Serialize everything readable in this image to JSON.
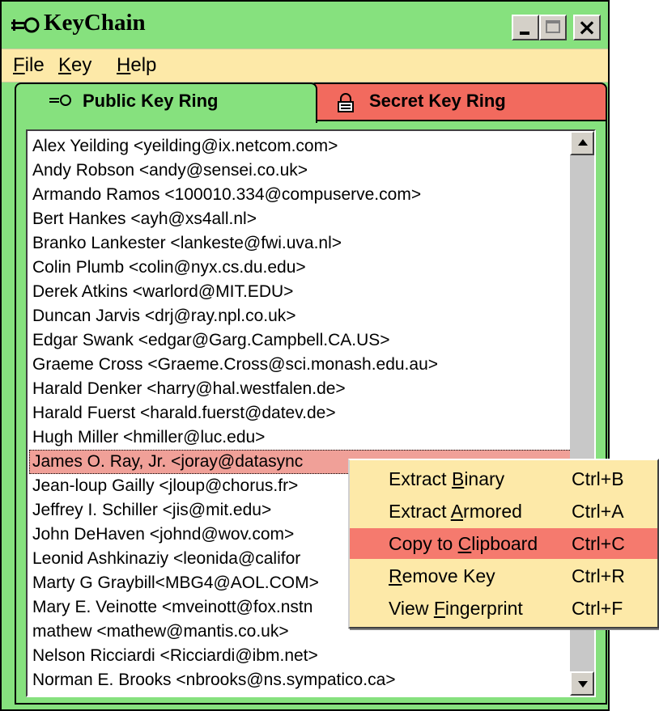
{
  "window": {
    "title": "KeyChain",
    "icon": "key-icon"
  },
  "menubar": [
    {
      "label": "File",
      "mnemonic": "F",
      "rest": "ile"
    },
    {
      "label": "Key",
      "mnemonic": "K",
      "rest": "ey"
    },
    {
      "label": "Help",
      "mnemonic": "H",
      "rest": "elp"
    }
  ],
  "tabs": [
    {
      "label": "Public Key Ring",
      "icon": "key-icon",
      "active": true,
      "color": "#86e17e"
    },
    {
      "label": "Secret Key Ring",
      "icon": "padlock-icon",
      "active": false,
      "color": "#f26a5e"
    }
  ],
  "keyring": {
    "selected_index": 13,
    "items": [
      "Alex Yeilding <yeilding@ix.netcom.com>",
      "Andy Robson <andy@sensei.co.uk>",
      "Armando Ramos <100010.334@compuserve.com>",
      "Bert Hankes <ayh@xs4all.nl>",
      "Branko Lankester  <lankeste@fwi.uva.nl>",
      "Colin Plumb <colin@nyx.cs.du.edu>",
      "Derek Atkins <warlord@MIT.EDU>",
      "Duncan Jarvis <drj@ray.npl.co.uk>",
      "Edgar Swank   <edgar@Garg.Campbell.CA.US>",
      "Graeme Cross <Graeme.Cross@sci.monash.edu.au>",
      "Harald Denker <harry@hal.westfalen.de>",
      "Harald Fuerst <harald.fuerst@datev.de>",
      "Hugh Miller <hmiller@luc.edu>",
      "James O. Ray, Jr. <joray@datasync",
      "Jean-loup Gailly <jloup@chorus.fr>",
      "Jeffrey I. Schiller <jis@mit.edu>",
      "John DeHaven <johnd@wov.com>",
      "Leonid Ashkinaziy <leonida@califor",
      "Marty G Graybill<MBG4@AOL.COM>",
      "Mary E. Veinotte <mveinott@fox.nstn",
      "mathew <mathew@mantis.co.uk>",
      "Nelson Ricciardi <Ricciardi@ibm.net>",
      "Norman E. Brooks <nbrooks@ns.sympatico.ca>"
    ]
  },
  "context_menu": {
    "items": [
      {
        "pre": "Extract ",
        "mnemonic": "B",
        "post": "inary",
        "label": "Extract Binary",
        "shortcut": "Ctrl+B",
        "active": false
      },
      {
        "pre": "Extract ",
        "mnemonic": "A",
        "post": "rmored",
        "label": "Extract Armored",
        "shortcut": "Ctrl+A",
        "active": false
      },
      {
        "pre": "Copy to ",
        "mnemonic": "C",
        "post": "lipboard",
        "label": "Copy to Clipboard",
        "shortcut": "Ctrl+C",
        "active": true
      },
      {
        "pre": "",
        "mnemonic": "R",
        "post": "emove Key",
        "label": "Remove Key",
        "shortcut": "Ctrl+R",
        "active": false
      },
      {
        "pre": "View ",
        "mnemonic": "F",
        "post": "ingerprint",
        "label": "View Fingerprint",
        "shortcut": "Ctrl+F",
        "active": false
      }
    ]
  },
  "colors": {
    "frame": "#86e17e",
    "menubar": "#fde9a8",
    "secret_tab": "#f26a5e",
    "highlight": "#f57a6e",
    "selected_row": "#f0a098"
  }
}
